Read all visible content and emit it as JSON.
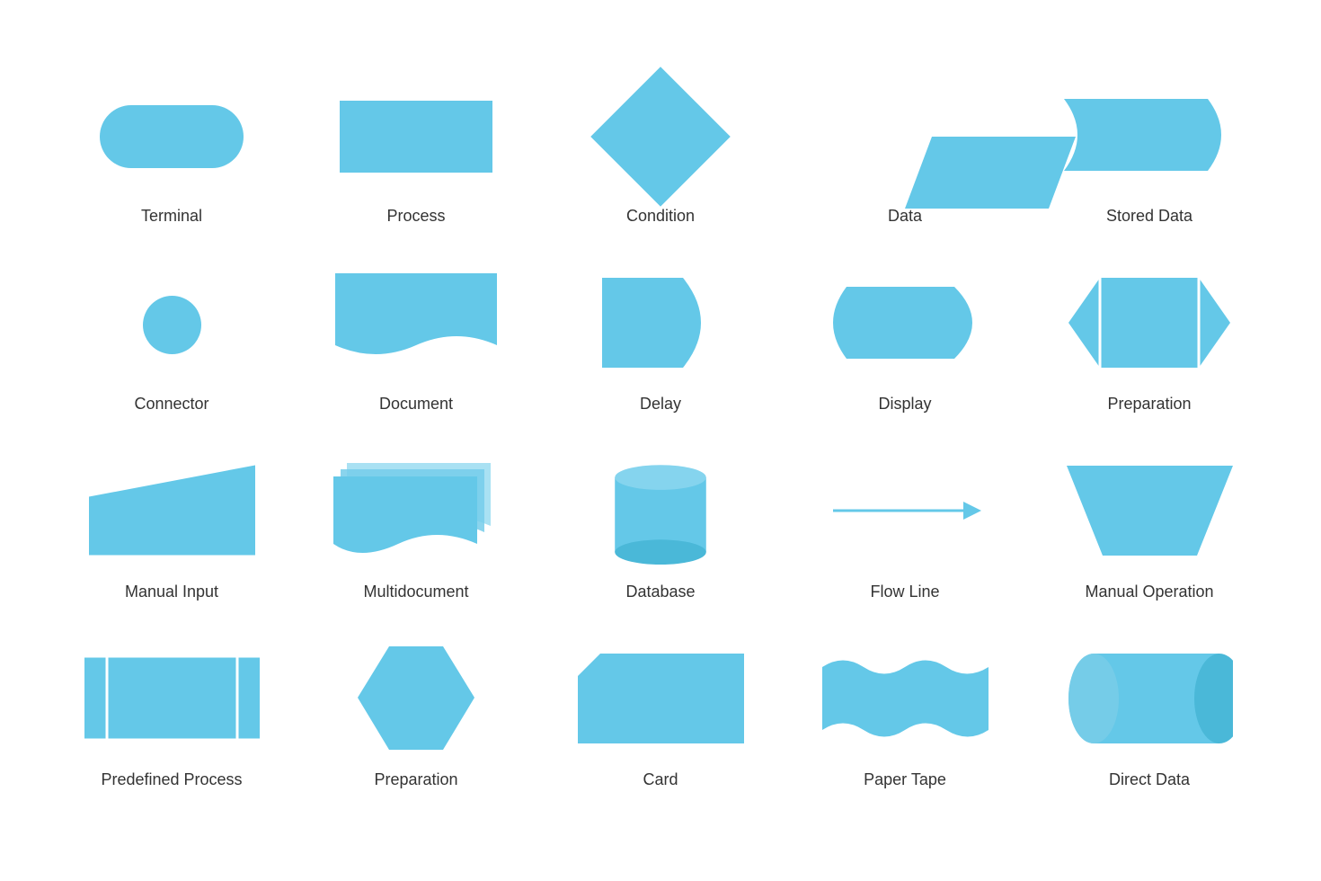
{
  "shapes": [
    {
      "id": "terminal",
      "label": "Terminal"
    },
    {
      "id": "process",
      "label": "Process"
    },
    {
      "id": "condition",
      "label": "Condition"
    },
    {
      "id": "data",
      "label": "Data"
    },
    {
      "id": "stored-data",
      "label": "Stored Data"
    },
    {
      "id": "connector",
      "label": "Connector"
    },
    {
      "id": "document",
      "label": "Document"
    },
    {
      "id": "delay",
      "label": "Delay"
    },
    {
      "id": "display",
      "label": "Display"
    },
    {
      "id": "preparation",
      "label": "Preparation"
    },
    {
      "id": "manual-input",
      "label": "Manual Input"
    },
    {
      "id": "multidocument",
      "label": "Multidocument"
    },
    {
      "id": "database",
      "label": "Database"
    },
    {
      "id": "flow-line",
      "label": "Flow Line"
    },
    {
      "id": "manual-operation",
      "label": "Manual Operation"
    },
    {
      "id": "predefined-process",
      "label": "Predefined Process"
    },
    {
      "id": "preparation2",
      "label": "Preparation"
    },
    {
      "id": "card",
      "label": "Card"
    },
    {
      "id": "paper-tape",
      "label": "Paper Tape"
    },
    {
      "id": "direct-data",
      "label": "Direct Data"
    }
  ],
  "color": "#64c8e8"
}
